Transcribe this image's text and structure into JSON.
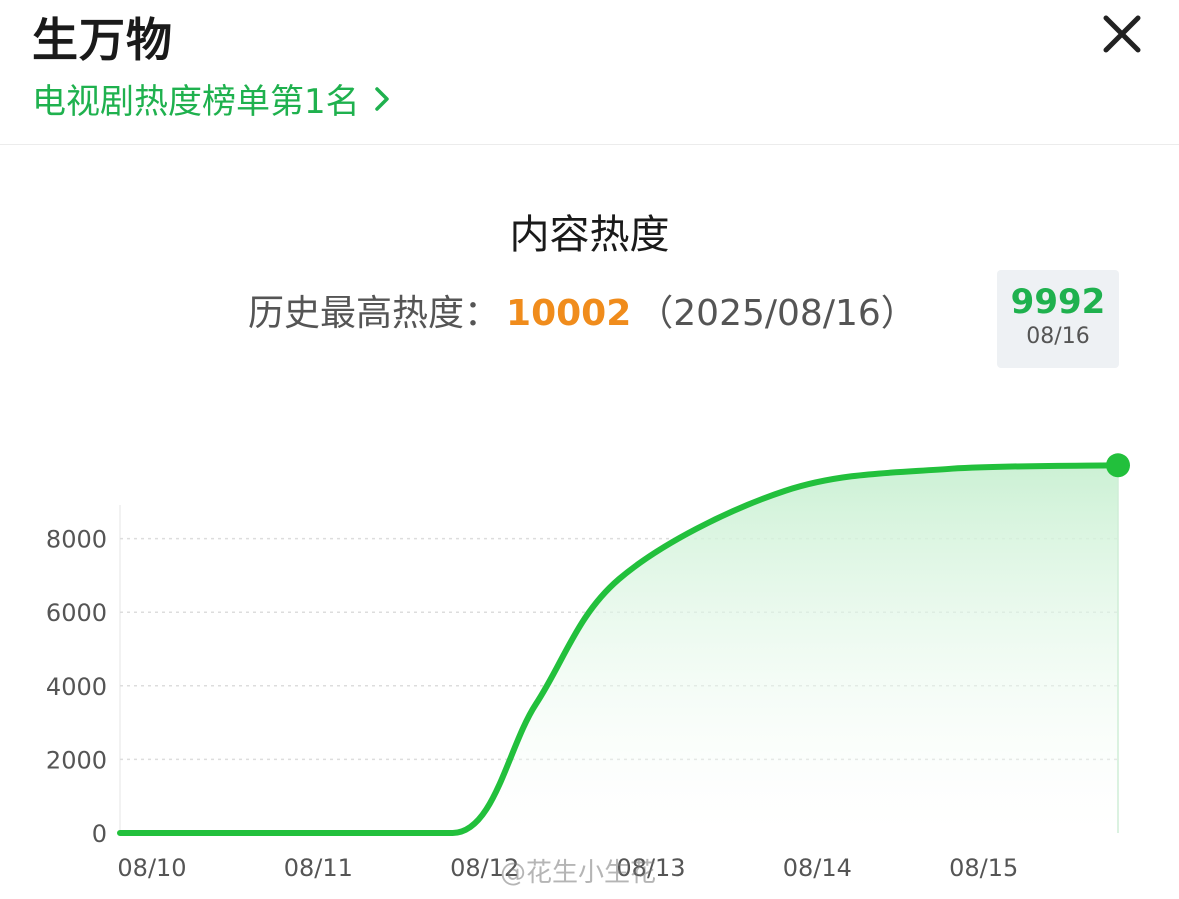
{
  "header": {
    "title": "生万物",
    "rank_link": "电视剧热度榜单第1名",
    "close_icon": "close-icon",
    "chevron_icon": "chevron-right-icon"
  },
  "chart_header": {
    "heading": "内容热度",
    "record_label": "历史最高热度：",
    "record_value": "10002",
    "record_date": "（2025/08/16）"
  },
  "tooltip": {
    "value": "9992",
    "date": "08/16"
  },
  "watermark": "@花生小生花",
  "colors": {
    "accent": "#1fb14e",
    "record": "#f08c1c",
    "line": "#22c03c",
    "fill": "#dff6e4"
  },
  "chart_data": {
    "type": "area",
    "title": "内容热度",
    "x": [
      "08/10",
      "08/11",
      "08/12",
      "08/12 12:00",
      "08/13",
      "08/14",
      "08/15",
      "08/16"
    ],
    "x_positions": [
      0,
      1,
      2,
      2.5,
      3,
      4,
      5,
      6
    ],
    "x_tick_labels": [
      "08/10",
      "08/11",
      "08/12",
      "08/13",
      "08/14",
      "08/15"
    ],
    "x_tick_positions": [
      0,
      1,
      2,
      3,
      4,
      5
    ],
    "y": [
      0,
      0,
      0,
      3500,
      6900,
      9300,
      9900,
      9992
    ],
    "y_ticks": [
      0,
      2000,
      4000,
      6000,
      8000
    ],
    "ylim": [
      0,
      10000
    ],
    "grid": true,
    "highlight": {
      "x": "08/16",
      "y": 9992
    }
  }
}
